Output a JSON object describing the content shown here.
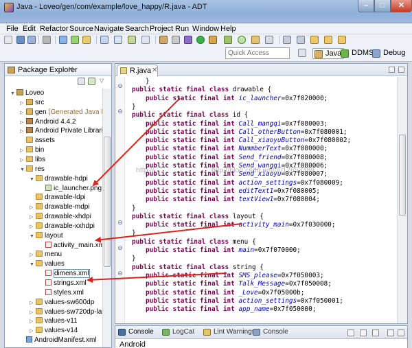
{
  "window": {
    "title": "Java - Loveo/gen/com/example/love_happy/R.java - ADT",
    "controls": {
      "minimize": "–",
      "maximize": "□",
      "close": "✕"
    }
  },
  "menu": [
    "File",
    "Edit",
    "Refactor",
    "Source",
    "Navigate",
    "Search",
    "Project",
    "Run",
    "Window",
    "Help"
  ],
  "quick_access": {
    "placeholder": "Quick Access"
  },
  "perspectives": [
    "Java",
    "DDMS",
    "Debug"
  ],
  "explorer": {
    "tab_label": "Package Explorer",
    "tab_close": "✕",
    "tree": [
      {
        "label": "Loveo",
        "arrow": "▼",
        "icon": "proj"
      },
      {
        "label": "src",
        "arrow": "▷",
        "icon": "src"
      },
      {
        "label": "gen",
        "extra": "[Generated Java Fi",
        "arrow": "▷",
        "icon": "src"
      },
      {
        "label": "Android 4.4.2",
        "arrow": "▷",
        "icon": "lib"
      },
      {
        "label": "Android Private Librari",
        "arrow": "▷",
        "icon": "lib"
      },
      {
        "label": "assets",
        "arrow": "",
        "icon": "folder"
      },
      {
        "label": "bin",
        "arrow": "▷",
        "icon": "folder"
      },
      {
        "label": "libs",
        "arrow": "▷",
        "icon": "folder"
      },
      {
        "label": "res",
        "arrow": "▼",
        "icon": "folder"
      },
      {
        "label": "drawable-hdpi",
        "arrow": "▼",
        "icon": "folder"
      },
      {
        "label": "ic_launcher.png",
        "arrow": "",
        "icon": "img"
      },
      {
        "label": "drawable-ldpi",
        "arrow": "",
        "icon": "folder"
      },
      {
        "label": "drawable-mdpi",
        "arrow": "▷",
        "icon": "folder"
      },
      {
        "label": "drawable-xhdpi",
        "arrow": "▷",
        "icon": "folder"
      },
      {
        "label": "drawable-xxhdpi",
        "arrow": "▷",
        "icon": "folder"
      },
      {
        "label": "layout",
        "arrow": "▼",
        "icon": "folder"
      },
      {
        "label": "activity_main.xml",
        "arrow": "",
        "icon": "xml"
      },
      {
        "label": "menu",
        "arrow": "▷",
        "icon": "folder"
      },
      {
        "label": "values",
        "arrow": "▼",
        "icon": "folder"
      },
      {
        "label": "dimens.xml",
        "arrow": "",
        "icon": "xml"
      },
      {
        "label": "strings.xml",
        "arrow": "",
        "icon": "xml"
      },
      {
        "label": "styles.xml",
        "arrow": "",
        "icon": "xml"
      },
      {
        "label": "values-sw600dp",
        "arrow": "▷",
        "icon": "folder"
      },
      {
        "label": "values-sw720dp-lar",
        "arrow": "▷",
        "icon": "folder"
      },
      {
        "label": "values-v11",
        "arrow": "▷",
        "icon": "folder"
      },
      {
        "label": "values-v14",
        "arrow": "▷",
        "icon": "folder"
      },
      {
        "label": "AndroidManifest.xml",
        "arrow": "",
        "icon": "mani"
      }
    ]
  },
  "editor": {
    "tab_label": "R.java",
    "tab_close": "✕",
    "lines": [
      {
        "indent": 2,
        "parts": [
          [
            "t",
            "}"
          ]
        ]
      },
      {
        "indent": 1,
        "parts": [
          [
            "k",
            "public static final class "
          ],
          [
            "t",
            "drawable {"
          ]
        ]
      },
      {
        "indent": 2,
        "parts": [
          [
            "k",
            "public static final int "
          ],
          [
            "f",
            "ic_launcher"
          ],
          [
            "t",
            "=0x7f020000;"
          ]
        ]
      },
      {
        "indent": 1,
        "parts": [
          [
            "t",
            "}"
          ]
        ]
      },
      {
        "indent": 1,
        "parts": [
          [
            "k",
            "public static final class "
          ],
          [
            "t",
            "id {"
          ]
        ]
      },
      {
        "indent": 2,
        "parts": [
          [
            "k",
            "public static final int "
          ],
          [
            "f",
            "Call_mangqi"
          ],
          [
            "t",
            "=0x7f080003;"
          ]
        ]
      },
      {
        "indent": 2,
        "parts": [
          [
            "k",
            "public static final int "
          ],
          [
            "f",
            "Call_otherButton"
          ],
          [
            "t",
            "=0x7f080001;"
          ]
        ]
      },
      {
        "indent": 2,
        "parts": [
          [
            "k",
            "public static final int "
          ],
          [
            "f",
            "Call_xiaoyuButton"
          ],
          [
            "t",
            "=0x7f080002;"
          ]
        ]
      },
      {
        "indent": 2,
        "parts": [
          [
            "k",
            "public static final int "
          ],
          [
            "f",
            "NummberText"
          ],
          [
            "t",
            "=0x7f080000;"
          ]
        ]
      },
      {
        "indent": 2,
        "parts": [
          [
            "k",
            "public static final int "
          ],
          [
            "f",
            "Send_friend"
          ],
          [
            "t",
            "=0x7f080008;"
          ]
        ]
      },
      {
        "indent": 2,
        "parts": [
          [
            "k",
            "public static final int "
          ],
          [
            "f",
            "Send_wangqi"
          ],
          [
            "t",
            "=0x7f080006;"
          ]
        ]
      },
      {
        "indent": 2,
        "parts": [
          [
            "k",
            "public static final int "
          ],
          [
            "f",
            "Send_xiaoyu"
          ],
          [
            "t",
            "=0x7f080007;"
          ]
        ]
      },
      {
        "indent": 2,
        "parts": [
          [
            "k",
            "public static final int "
          ],
          [
            "f",
            "action_settings"
          ],
          [
            "t",
            "=0x7f080009;"
          ]
        ]
      },
      {
        "indent": 2,
        "parts": [
          [
            "k",
            "public static final int "
          ],
          [
            "f",
            "editText1"
          ],
          [
            "t",
            "=0x7f080005;"
          ]
        ]
      },
      {
        "indent": 2,
        "parts": [
          [
            "k",
            "public static final int "
          ],
          [
            "f",
            "textView1"
          ],
          [
            "t",
            "=0x7f080004;"
          ]
        ]
      },
      {
        "indent": 1,
        "parts": [
          [
            "t",
            "}"
          ]
        ]
      },
      {
        "indent": 1,
        "parts": [
          [
            "k",
            "public static final class "
          ],
          [
            "t",
            "layout {"
          ]
        ]
      },
      {
        "indent": 2,
        "parts": [
          [
            "k",
            "public static final int "
          ],
          [
            "f",
            "activity_main"
          ],
          [
            "t",
            "=0x7f030000;"
          ]
        ]
      },
      {
        "indent": 1,
        "parts": [
          [
            "t",
            "}"
          ]
        ]
      },
      {
        "indent": 1,
        "parts": [
          [
            "k",
            "public static final class "
          ],
          [
            "t",
            "menu {"
          ]
        ]
      },
      {
        "indent": 2,
        "parts": [
          [
            "k",
            "public static final int "
          ],
          [
            "f",
            "main"
          ],
          [
            "t",
            "=0x7f070000;"
          ]
        ]
      },
      {
        "indent": 1,
        "parts": [
          [
            "t",
            "}"
          ]
        ]
      },
      {
        "indent": 1,
        "parts": [
          [
            "k",
            "public static final class "
          ],
          [
            "t",
            "string {"
          ]
        ]
      },
      {
        "indent": 2,
        "parts": [
          [
            "k",
            "public static final int "
          ],
          [
            "f",
            "SMS_please"
          ],
          [
            "t",
            "=0x7f050003;"
          ]
        ]
      },
      {
        "indent": 2,
        "parts": [
          [
            "k",
            "public static final int "
          ],
          [
            "f",
            "Talk_Message"
          ],
          [
            "t",
            "=0x7f050008;"
          ]
        ]
      },
      {
        "indent": 2,
        "parts": [
          [
            "k",
            "public static final int "
          ],
          [
            "f",
            "_Love"
          ],
          [
            "t",
            "=0x7f05000b;"
          ]
        ]
      },
      {
        "indent": 2,
        "parts": [
          [
            "k",
            "public static final int "
          ],
          [
            "f",
            "action_settings"
          ],
          [
            "t",
            "=0x7f050001;"
          ]
        ]
      },
      {
        "indent": 2,
        "parts": [
          [
            "k",
            "public static final int "
          ],
          [
            "f",
            "app_name"
          ],
          [
            "t",
            "=0x7f050000;"
          ]
        ]
      }
    ]
  },
  "watermark": "http://blog.csdn.net/u012653389",
  "bottom_panel": {
    "tabs": [
      "Console",
      "LogCat",
      "Lint Warnings",
      "Console"
    ],
    "content": "Android"
  },
  "colors": {
    "keyword": "#7f0055",
    "field": "#0000c0",
    "arrow": "#e0201a",
    "title_bar": "#9fbadf"
  }
}
